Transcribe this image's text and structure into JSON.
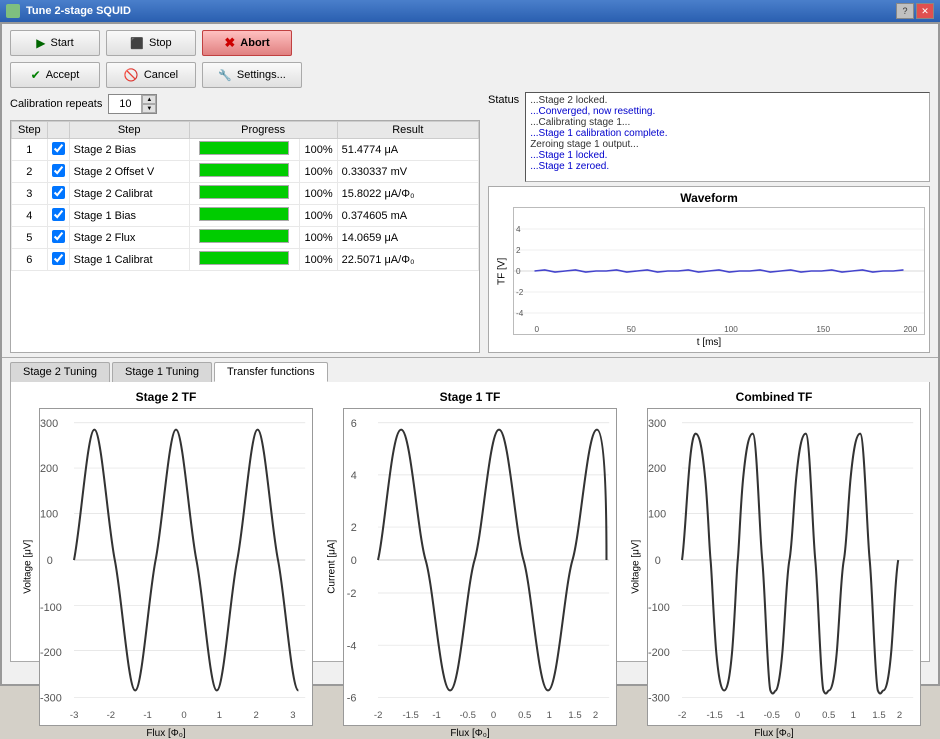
{
  "window": {
    "title": "Tune 2-stage SQUID"
  },
  "toolbar": {
    "start_label": "Start",
    "stop_label": "Stop",
    "abort_label": "Abort",
    "accept_label": "Accept",
    "cancel_label": "Cancel",
    "settings_label": "Settings..."
  },
  "calibration": {
    "repeats_label": "Calibration repeats",
    "repeats_value": "10"
  },
  "table": {
    "headers": [
      "Step",
      "",
      "Step",
      "Progress",
      "",
      "Result"
    ],
    "rows": [
      {
        "num": "1",
        "checked": true,
        "name": "Stage 2 Bias",
        "progress": 100,
        "percent": "100%",
        "result": "51.4774 μA"
      },
      {
        "num": "2",
        "checked": true,
        "name": "Stage 2 Offset V",
        "progress": 100,
        "percent": "100%",
        "result": "0.330337 mV"
      },
      {
        "num": "3",
        "checked": true,
        "name": "Stage 2 Calibrat",
        "progress": 100,
        "percent": "100%",
        "result": "15.8022 μA/Φ₀"
      },
      {
        "num": "4",
        "checked": true,
        "name": "Stage 1 Bias",
        "progress": 100,
        "percent": "100%",
        "result": "0.374605 mA"
      },
      {
        "num": "5",
        "checked": true,
        "name": "Stage 2 Flux",
        "progress": 100,
        "percent": "100%",
        "result": "14.0659 μA"
      },
      {
        "num": "6",
        "checked": true,
        "name": "Stage 1 Calibrat",
        "progress": 100,
        "percent": "100%",
        "result": "22.5071 μA/Φ₀"
      }
    ]
  },
  "status": {
    "label": "Status",
    "messages": [
      {
        "text": "...Stage 2 locked.",
        "class": ""
      },
      {
        "text": "...Converged, now resetting.",
        "class": "blue"
      },
      {
        "text": "...Calibrating stage 1...",
        "class": ""
      },
      {
        "text": "...Stage 1 calibration complete.",
        "class": "blue"
      },
      {
        "text": "Zeroing stage 1 output...",
        "class": ""
      },
      {
        "text": "...Stage 1 locked.",
        "class": "blue"
      },
      {
        "text": "...Stage 1 zeroed.",
        "class": "blue"
      }
    ]
  },
  "waveform": {
    "title": "Waveform",
    "y_label": "TF [V]",
    "x_label": "t [ms]",
    "x_ticks": [
      "0",
      "50",
      "100",
      "150",
      "200"
    ],
    "y_ticks": [
      "4",
      "2",
      "0",
      "-2",
      "-4"
    ]
  },
  "tabs": [
    {
      "label": "Stage 2 Tuning",
      "active": false
    },
    {
      "label": "Stage 1 Tuning",
      "active": false
    },
    {
      "label": "Transfer functions",
      "active": true
    }
  ],
  "charts": [
    {
      "title": "Stage 2 TF",
      "y_label": "Voltage [μV]",
      "x_label": "Flux [Φ₀]",
      "y_ticks": [
        "300",
        "200",
        "100",
        "0",
        "-100",
        "-200",
        "-300"
      ],
      "x_ticks": [
        "-3",
        "-2",
        "-1",
        "0",
        "1",
        "2",
        "3"
      ]
    },
    {
      "title": "Stage 1 TF",
      "y_label": "Current [μA]",
      "x_label": "Flux [Φ₀]",
      "y_ticks": [
        "6",
        "4",
        "2",
        "0",
        "-2",
        "-4",
        "-6"
      ],
      "x_ticks": [
        "-2",
        "-1.5",
        "-1",
        "-0.5",
        "0",
        "0.5",
        "1",
        "1.5",
        "2"
      ]
    },
    {
      "title": "Combined TF",
      "y_label": "Voltage [μV]",
      "x_label": "Flux [Φ₀]",
      "y_ticks": [
        "300",
        "200",
        "100",
        "0",
        "-100",
        "-200",
        "-300"
      ],
      "x_ticks": [
        "-2",
        "-1.5",
        "-1",
        "-0.5",
        "0",
        "0.5",
        "1",
        "1.5",
        "2"
      ]
    }
  ]
}
